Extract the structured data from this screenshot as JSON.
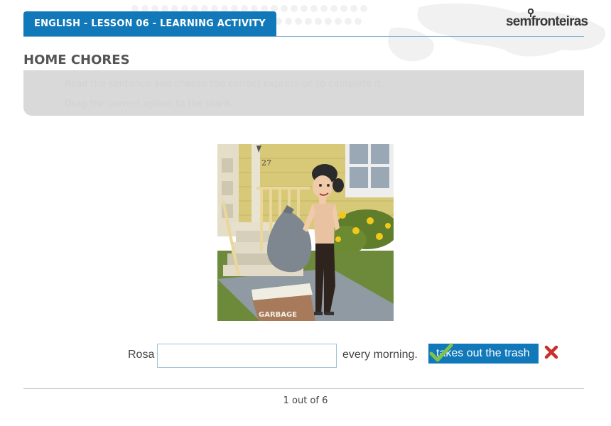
{
  "header": {
    "title": "ENGLISH - LESSON 06 - LEARNING ACTIVITY",
    "logo_text": "semfronteiras",
    "accent_color": "#1178b9"
  },
  "page_title": "HOME CHORES",
  "instruction": {
    "line1": "Read the sentence and choose the correct expression to complete it.",
    "line2": "Drag the correct option to the blank."
  },
  "illustration": {
    "house_number": "27",
    "bag_label": "GARBAGE"
  },
  "exercise": {
    "prefix": "Rosa",
    "input_value": "",
    "suffix": "every morning.",
    "option": "takes out the trash"
  },
  "pager": {
    "text": "1 out of 6"
  }
}
